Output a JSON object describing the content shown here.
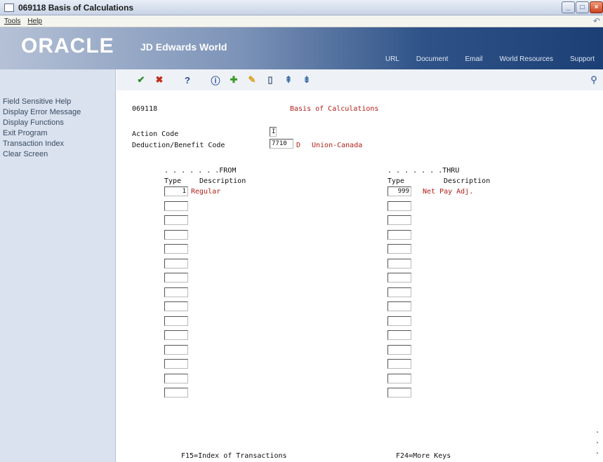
{
  "window": {
    "title": "069118   Basis of Calculations"
  },
  "menu": {
    "items": [
      "Tools",
      "Help"
    ]
  },
  "banner": {
    "oracle": "ORACLE",
    "product": "JD Edwards World",
    "links": [
      "URL",
      "Document",
      "Email",
      "World Resources",
      "Support"
    ]
  },
  "left_panel": {
    "items": [
      "Field Sensitive Help",
      "Display Error Message",
      "Display Functions",
      "Exit Program",
      "Transaction Index",
      "Clear Screen"
    ]
  },
  "form": {
    "program_id": "069118",
    "screen_title": "Basis of Calculations",
    "action_code_label": "Action Code",
    "action_code_value": "I",
    "deduction_label": "Deduction/Benefit Code",
    "deduction_code": "7710",
    "deduction_type": "D",
    "deduction_desc": "Union-Canada",
    "from_header": ". . . . . . .FROM",
    "thru_header": ". . . . . . .THRU",
    "type_label": "Type",
    "description_label": "Description",
    "from_rows": [
      {
        "type": "1",
        "desc": "Regular"
      },
      {
        "type": "",
        "desc": ""
      },
      {
        "type": "",
        "desc": ""
      },
      {
        "type": "",
        "desc": ""
      },
      {
        "type": "",
        "desc": ""
      },
      {
        "type": "",
        "desc": ""
      },
      {
        "type": "",
        "desc": ""
      },
      {
        "type": "",
        "desc": ""
      },
      {
        "type": "",
        "desc": ""
      },
      {
        "type": "",
        "desc": ""
      },
      {
        "type": "",
        "desc": ""
      },
      {
        "type": "",
        "desc": ""
      },
      {
        "type": "",
        "desc": ""
      },
      {
        "type": "",
        "desc": ""
      },
      {
        "type": "",
        "desc": ""
      }
    ],
    "thru_rows": [
      {
        "type": "999",
        "desc": "Net Pay Adj."
      },
      {
        "type": "",
        "desc": ""
      },
      {
        "type": "",
        "desc": ""
      },
      {
        "type": "",
        "desc": ""
      },
      {
        "type": "",
        "desc": ""
      },
      {
        "type": "",
        "desc": ""
      },
      {
        "type": "",
        "desc": ""
      },
      {
        "type": "",
        "desc": ""
      },
      {
        "type": "",
        "desc": ""
      },
      {
        "type": "",
        "desc": ""
      },
      {
        "type": "",
        "desc": ""
      },
      {
        "type": "",
        "desc": ""
      },
      {
        "type": "",
        "desc": ""
      },
      {
        "type": "",
        "desc": ""
      },
      {
        "type": "",
        "desc": ""
      }
    ],
    "f15": "F15=Index of Transactions",
    "f24": "F24=More Keys"
  },
  "colors": {
    "accent_red": "#b0201a",
    "banner_blue": "#1c3f75"
  }
}
